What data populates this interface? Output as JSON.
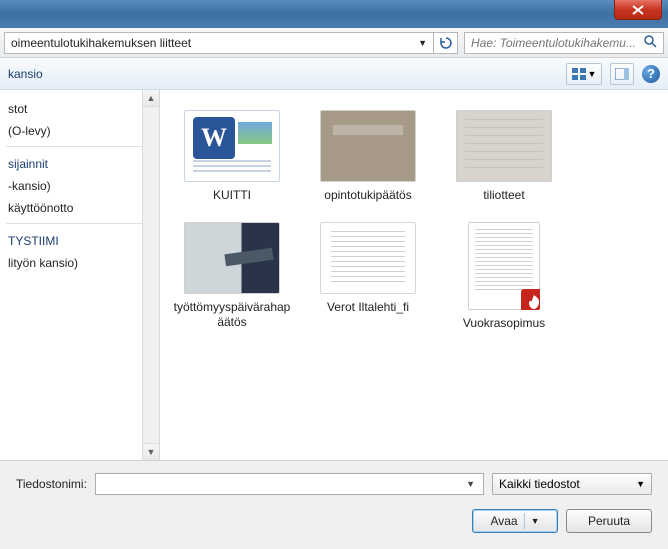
{
  "titlebar": {},
  "addressbar": {
    "path_text": "oimeentulotukihakemuksen liitteet",
    "search_placeholder": "Hae: Toimeentulotukihakemu..."
  },
  "toolbar": {
    "new_folder": "kansio"
  },
  "sidebar": {
    "items": [
      {
        "label": "stot"
      },
      {
        "label": "(O-levy)"
      },
      {
        "label": "sijainnit",
        "header": true
      },
      {
        "label": "-kansio)"
      },
      {
        "label": "käyttöönotto"
      },
      {
        "label": "TYSTIIMI",
        "header": true
      },
      {
        "label": "lityön kansio)"
      }
    ]
  },
  "files": [
    {
      "label": "KUITTI",
      "thumb": "word"
    },
    {
      "label": "opintotukipäätös",
      "thumb": "photo1"
    },
    {
      "label": "tiliotteet",
      "thumb": "photo2"
    },
    {
      "label": "työttömyyspäivärahapäätös",
      "thumb": "photo3"
    },
    {
      "label": "Verot  Iltalehti_fi",
      "thumb": "text"
    },
    {
      "label": "Vuokrasopimus",
      "thumb": "pdf"
    }
  ],
  "footer": {
    "filename_label": "Tiedostonimi:",
    "filename_value": "",
    "filter_label": "Kaikki tiedostot",
    "open_label": "Avaa",
    "cancel_label": "Peruuta"
  }
}
